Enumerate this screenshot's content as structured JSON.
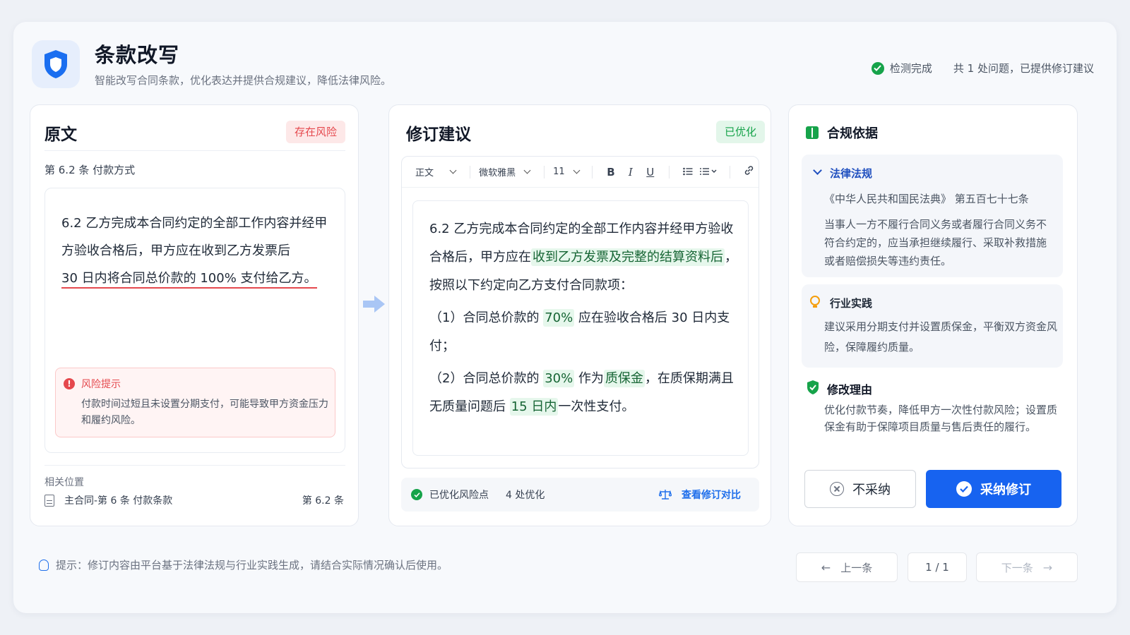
{
  "header": {
    "title": "条款改写",
    "subtitle": "智能改写合同条款，优化表达并提供合规建议，降低法律风险。",
    "status_label": "检测完成",
    "status_detail": "共 1 处问题，已提供修订建议"
  },
  "original": {
    "title": "原文",
    "badge": "存在风险",
    "clause_heading": "第 6.2 条  付款方式",
    "text_normal": "6.2  乙方完成本合同约定的全部工作内容并经甲方验收合格后，甲方应在收到乙方发票后",
    "text_risk": "30 日内将合同总价款的 100% 支付给乙方。",
    "risk_title": "风险提示",
    "risk_text": "付款时间过短且未设置分期支付，可能导致甲方资金压力和履约风险。",
    "location_label": "相关位置",
    "location_doc": "主合同-第 6 条 付款条款",
    "location_ref": "第 6.2 条"
  },
  "revision": {
    "title": "修订建议",
    "badge": "已优化",
    "toolbar": {
      "style": "正文",
      "font": "微软雅黑",
      "size": "11",
      "bold": "B",
      "italic": "I",
      "underline": "U"
    },
    "p1_a": "6.2  乙方完成本合同约定的全部工作内容并经甲方验收合格后，甲方应在",
    "p1_hl": "收到乙方发票及完整的结算资料后",
    "p1_b": "，按照以下约定向乙方支付合同款项：",
    "p2_a": "（1）合同总价款的 ",
    "p2_hl": "70%",
    "p2_b": " 应在验收合格后 30 日内支付；",
    "p3_a": "（2）合同总价款的 ",
    "p3_hl1": "30%",
    "p3_b": " 作为",
    "p3_hl2": "质保金",
    "p3_c": "，在质保期满且无质量问题后 ",
    "p3_hl3": "15 日内",
    "p3_d": "一次性支付。",
    "footer_status": "已优化风险点",
    "footer_count": "4 处优化",
    "footer_compare": "查看修订对比"
  },
  "basis": {
    "title": "合规依据",
    "law_title": "法律法规",
    "law_source": "《中华人民共和国民法典》  第五百七十七条",
    "law_text": "当事人一方不履行合同义务或者履行合同义务不符合约定的，应当承担继续履行、采取补救措施或者赔偿损失等违约责任。",
    "practice_title": "行业实践",
    "practice_text": "建议采用分期支付并设置质保金，平衡双方资金风险，保障履约质量。",
    "reason_title": "修改理由",
    "reason_text": "优化付款节奏，降低甲方一次性付款风险；设置质保金有助于保障项目质量与售后责任的履行。",
    "reject_label": "不采纳",
    "accept_label": "采纳修订"
  },
  "footer": {
    "tip": "提示：修订内容由平台基于法律法规与行业实践生成，请结合实际情况确认后使用。",
    "prev": "上一条",
    "page": "1 / 1",
    "next": "下一条"
  },
  "colors": {
    "primary": "#1763f0",
    "risk": "#e5484d",
    "success": "#16a34a",
    "highlight_bg": "#e6f7ec"
  }
}
